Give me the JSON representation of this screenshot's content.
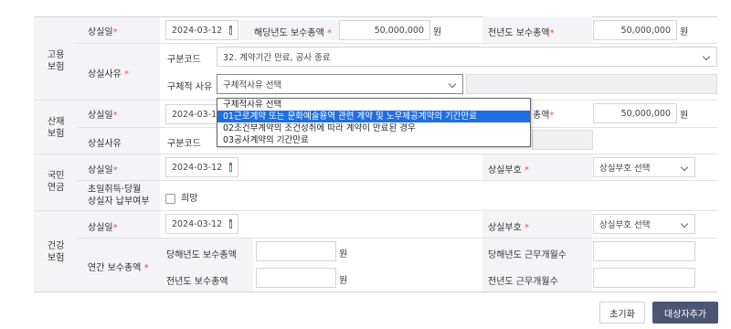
{
  "common": {
    "required": "*",
    "won": "원"
  },
  "employment": {
    "section_label": "고용\n보험",
    "loss_date_label": "상실일",
    "loss_date_value": "2024-03-12",
    "cur_year_pay_label": "해당년도 보수총액",
    "cur_year_pay_value": "50,000,000",
    "prev_year_pay_label": "전년도 보수총액",
    "prev_year_pay_value": "50,000,000",
    "reason_label": "상실사유",
    "code_label": "구분코드",
    "code_value": "32. 계약기간 만료, 공사 종료",
    "detail_reason_label": "구체적 사유",
    "detail_reason_value": "구체적사유 선택",
    "dropdown_options": [
      "구체적사유 선택",
      "01근로계약 또는 문화예술용역 관련 계약 및 노무제공계약의 기간만료",
      "02조건부계약의 조건성취에 따라 계약이 만료된 경우",
      "03공사계약의 기간만료"
    ]
  },
  "industrial": {
    "section_label": "산재\n보험",
    "loss_date_label": "상실일",
    "loss_date_value": "2024-03-12",
    "prev_year_pay_label_fragment": "총액",
    "prev_year_pay_value": "50,000,000",
    "reason_label": "상실사유",
    "code_label": "구분코드"
  },
  "pension": {
    "section_label": "국민\n연금",
    "loss_date_label": "상실일",
    "loss_date_value": "2024-03-12",
    "loss_code_label": "상실부호",
    "loss_code_value": "상실부호 선택",
    "acq_month_label": "초일취득·당월\n상실자 납부여부",
    "wish_label": "희망"
  },
  "health": {
    "section_label": "건강\n보험",
    "loss_date_label": "상실일",
    "loss_date_value": "2024-03-12",
    "loss_code_label": "상실부호",
    "loss_code_value": "상실부호 선택",
    "annual_pay_label": "연간 보수총액",
    "cur_year_pay_label": "당해년도 보수총액",
    "cur_year_months_label": "당해년도 근무개월수",
    "prev_year_pay_label": "전년도 보수총액",
    "prev_year_months_label": "전년도 근무개월수"
  },
  "buttons": {
    "reset": "초기화",
    "add": "대상자추가"
  }
}
